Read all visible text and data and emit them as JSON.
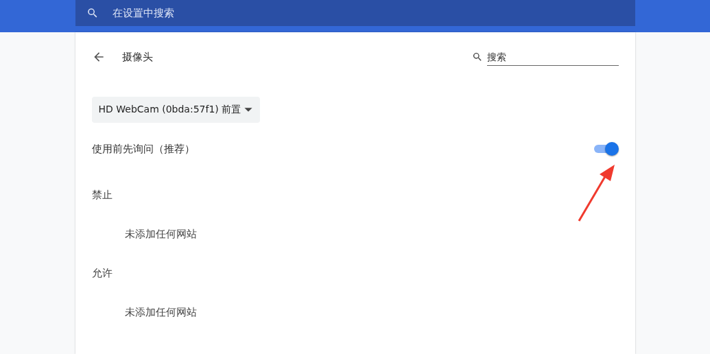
{
  "top_search": {
    "placeholder": "在设置中搜索"
  },
  "header": {
    "title": "摄像头",
    "search": {
      "placeholder": "搜索"
    }
  },
  "device_select": {
    "value": "HD WebCam (0bda:57f1) 前置"
  },
  "ask_toggle": {
    "label": "使用前先询问（推荐）",
    "on": true
  },
  "sections": [
    {
      "title": "禁止",
      "empty": "未添加任何网站"
    },
    {
      "title": "允许",
      "empty": "未添加任何网站"
    }
  ]
}
